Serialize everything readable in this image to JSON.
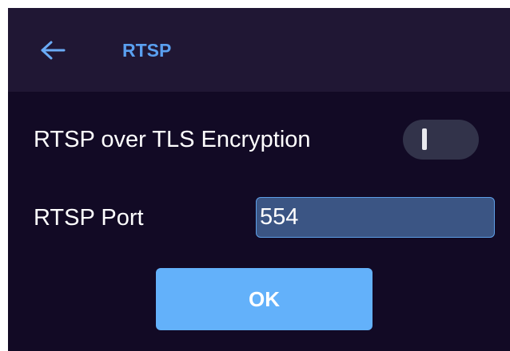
{
  "header": {
    "back_icon": "arrow-left-icon",
    "title": "RTSP"
  },
  "settings": {
    "tls_label": "RTSP over TLS Encryption",
    "tls_enabled": false,
    "port_label": "RTSP Port",
    "port_value": "554"
  },
  "actions": {
    "ok_label": "OK"
  },
  "colors": {
    "background": "#120a25",
    "header_background": "#201734",
    "accent": "#5aa0f0",
    "button": "#63b1fa",
    "input_background": "#3b5584",
    "toggle_track": "#32334a"
  }
}
